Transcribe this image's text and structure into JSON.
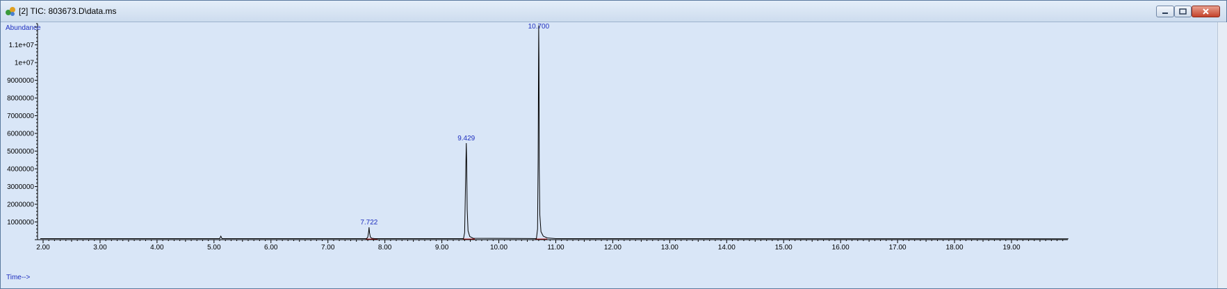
{
  "window": {
    "title": "[2] TIC: 803673.D\\data.ms",
    "icon": "chromatogram-app-icon",
    "controls": [
      "minimize",
      "maximize",
      "close"
    ]
  },
  "chart_data": {
    "type": "line",
    "title": "",
    "ylabel": "Abundance",
    "xlabel": "Time-->",
    "xlim": [
      1.95,
      20.0
    ],
    "ylim": [
      0,
      12200000
    ],
    "x_ticks": [
      2,
      3,
      4,
      5,
      6,
      7,
      8,
      9,
      10,
      11,
      12,
      13,
      14,
      15,
      16,
      17,
      18,
      19
    ],
    "x_tick_labels": [
      "2.00",
      "3.00",
      "4.00",
      "5.00",
      "6.00",
      "7.00",
      "8.00",
      "9.00",
      "10.00",
      "11.00",
      "12.00",
      "13.00",
      "14.00",
      "15.00",
      "16.00",
      "17.00",
      "18.00",
      "19.00"
    ],
    "y_ticks": [
      1000000,
      2000000,
      3000000,
      4000000,
      5000000,
      6000000,
      7000000,
      8000000,
      9000000,
      10000000,
      11000000
    ],
    "y_tick_labels": [
      "1000000",
      "2000000",
      "3000000",
      "4000000",
      "5000000",
      "6000000",
      "7000000",
      "8000000",
      "9000000",
      "1e+07",
      "1.1e+07"
    ],
    "grid": false,
    "colors": {
      "trace": "#000000",
      "peak_labels": "#1f2fbf",
      "axis_labels": "#1f2fbf",
      "integration": "#c02020",
      "background": "#d9e6f7"
    },
    "series": [
      {
        "x": [
          1.95,
          5.1,
          5.12,
          5.14,
          7.68,
          7.7,
          7.715,
          7.722,
          7.73,
          7.745,
          7.77,
          7.82,
          9.38,
          9.4,
          9.415,
          9.429,
          9.435,
          9.445,
          9.46,
          9.49,
          9.55,
          10.66,
          10.68,
          10.69,
          10.7,
          10.705,
          10.71,
          10.72,
          10.74,
          10.78,
          10.85,
          11.0,
          20.0
        ],
        "y": [
          60000,
          60000,
          200000,
          60000,
          60000,
          150000,
          450000,
          700000,
          400000,
          150000,
          80000,
          60000,
          60000,
          400000,
          3000000,
          5450000,
          4500000,
          1700000,
          500000,
          180000,
          80000,
          60000,
          600000,
          4500000,
          12100000,
          10200000,
          4000000,
          1400000,
          450000,
          200000,
          100000,
          60000,
          50000
        ]
      }
    ],
    "peak_labels": [
      {
        "x": 7.722,
        "y": 700000,
        "label": "7.722"
      },
      {
        "x": 9.429,
        "y": 5450000,
        "label": "9.429"
      },
      {
        "x": 10.7,
        "y": 12100000,
        "label": "10.700"
      }
    ]
  }
}
